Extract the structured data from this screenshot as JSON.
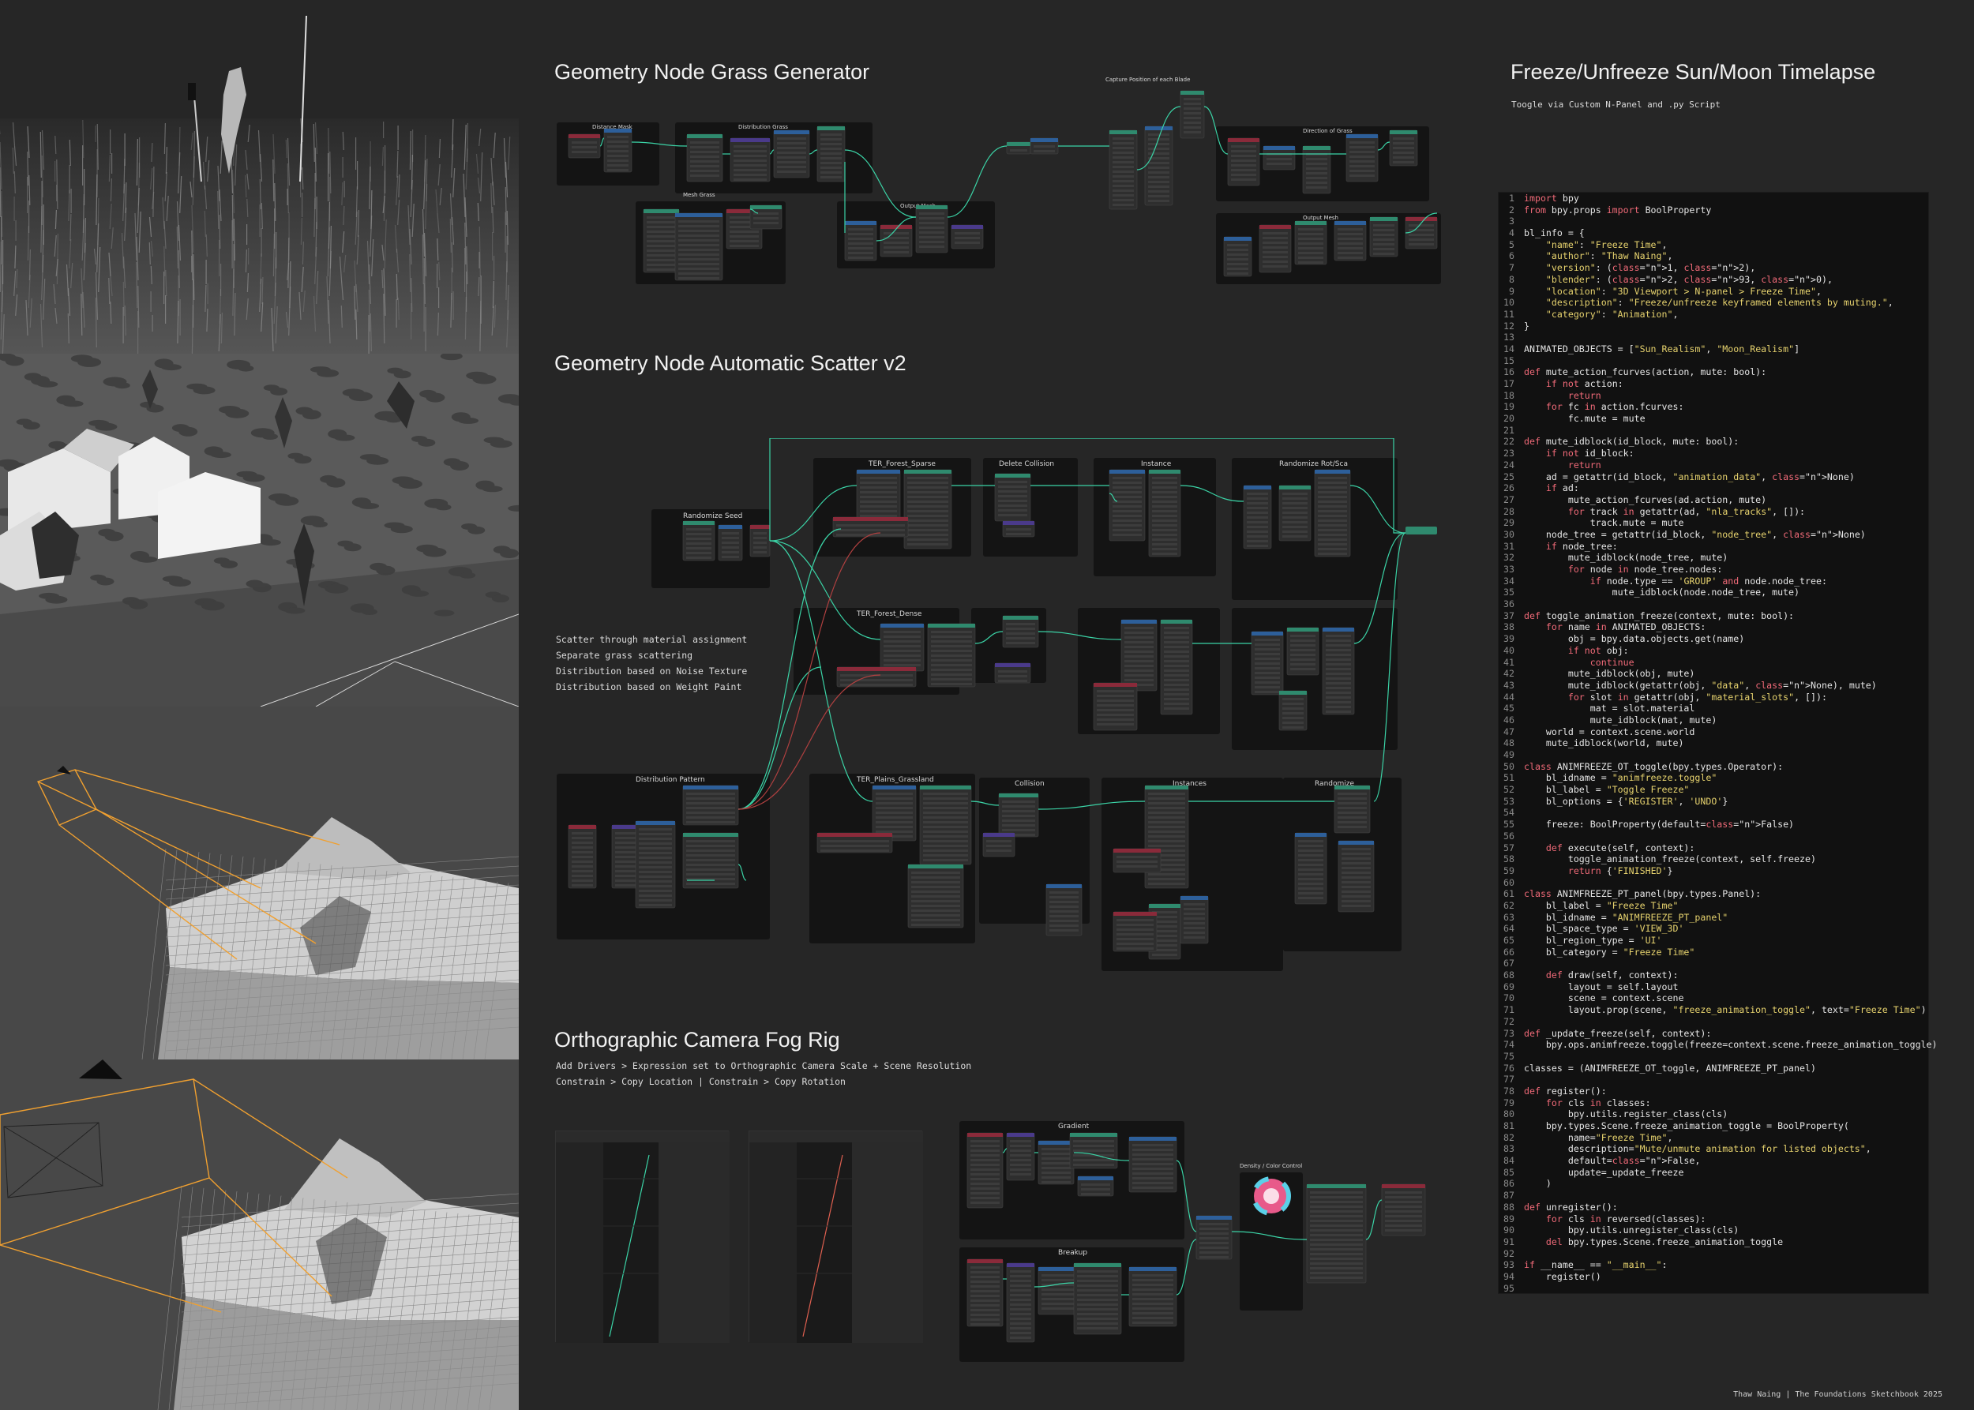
{
  "sections": {
    "grass": {
      "title": "Geometry Node Grass Generator"
    },
    "scatter": {
      "title": "Geometry Node Automatic Scatter v2",
      "notes": [
        "Scatter through material assignment",
        "Separate grass scattering",
        "Distribution based on Noise Texture",
        "Distribution based on Weight Paint"
      ]
    },
    "fog": {
      "title": "Orthographic Camera Fog Rig",
      "notes": [
        "Add Drivers > Expression set to Orthographic Camera Scale + Scene Resolution",
        "Constrain > Copy Location | Constrain > Copy Rotation"
      ]
    },
    "freeze": {
      "title": "Freeze/Unfreeze Sun/Moon Timelapse",
      "subtitle": "Toogle via Custom N-Panel and .py Script"
    }
  },
  "node_frames": {
    "grass": [
      "Distance Mask",
      "Distribution Grass",
      "Mesh Grass",
      "Output Mesh",
      "Capture Position of each Blade",
      "Direction of Grass",
      "Output Mesh"
    ],
    "scatter": [
      "Randomize Seed",
      "TER_Forest_Sparse",
      "Delete Collision",
      "Instance",
      "Randomize Rot/Sca",
      "TER_Forest_Dense",
      "Distribution Pattern",
      "TER_Plains_Grassland",
      "Collision",
      "Instances",
      "Randomize"
    ],
    "fog": [
      "Gradient",
      "Breakup",
      "Density / Color Control"
    ]
  },
  "code_lines": [
    "import bpy",
    "from bpy.props import BoolProperty",
    "",
    "bl_info = {",
    "    \"name\": \"Freeze Time\",",
    "    \"author\": \"Thaw Naing\",",
    "    \"version\": (1, 2),",
    "    \"blender\": (2, 93, 0),",
    "    \"location\": \"3D Viewport > N-panel > Freeze Time\",",
    "    \"description\": \"Freeze/unfreeze keyframed elements by muting.\",",
    "    \"category\": \"Animation\",",
    "}",
    "",
    "ANIMATED_OBJECTS = [\"Sun_Realism\", \"Moon_Realism\"]",
    "",
    "def mute_action_fcurves(action, mute: bool):",
    "    if not action:",
    "        return",
    "    for fc in action.fcurves:",
    "        fc.mute = mute",
    "",
    "def mute_idblock(id_block, mute: bool):",
    "    if not id_block:",
    "        return",
    "    ad = getattr(id_block, \"animation_data\", None)",
    "    if ad:",
    "        mute_action_fcurves(ad.action, mute)",
    "        for track in getattr(ad, \"nla_tracks\", []):",
    "            track.mute = mute",
    "    node_tree = getattr(id_block, \"node_tree\", None)",
    "    if node_tree:",
    "        mute_idblock(node_tree, mute)",
    "        for node in node_tree.nodes:",
    "            if node.type == 'GROUP' and node.node_tree:",
    "                mute_idblock(node.node_tree, mute)",
    "",
    "def toggle_animation_freeze(context, mute: bool):",
    "    for name in ANIMATED_OBJECTS:",
    "        obj = bpy.data.objects.get(name)",
    "        if not obj:",
    "            continue",
    "        mute_idblock(obj, mute)",
    "        mute_idblock(getattr(obj, \"data\", None), mute)",
    "        for slot in getattr(obj, \"material_slots\", []):",
    "            mat = slot.material",
    "            mute_idblock(mat, mute)",
    "    world = context.scene.world",
    "    mute_idblock(world, mute)",
    "",
    "class ANIMFREEZE_OT_toggle(bpy.types.Operator):",
    "    bl_idname = \"animfreeze.toggle\"",
    "    bl_label = \"Toggle Freeze\"",
    "    bl_options = {'REGISTER', 'UNDO'}",
    "",
    "    freeze: BoolProperty(default=False)",
    "",
    "    def execute(self, context):",
    "        toggle_animation_freeze(context, self.freeze)",
    "        return {'FINISHED'}",
    "",
    "class ANIMFREEZE_PT_panel(bpy.types.Panel):",
    "    bl_label = \"Freeze Time\"",
    "    bl_idname = \"ANIMFREEZE_PT_panel\"",
    "    bl_space_type = 'VIEW_3D'",
    "    bl_region_type = 'UI'",
    "    bl_category = \"Freeze Time\"",
    "",
    "    def draw(self, context):",
    "        layout = self.layout",
    "        scene = context.scene",
    "        layout.prop(scene, \"freeze_animation_toggle\", text=\"Freeze Time\")",
    "",
    "def _update_freeze(self, context):",
    "    bpy.ops.animfreeze.toggle(freeze=context.scene.freeze_animation_toggle)",
    "",
    "classes = (ANIMFREEZE_OT_toggle, ANIMFREEZE_PT_panel)",
    "",
    "def register():",
    "    for cls in classes:",
    "        bpy.utils.register_class(cls)",
    "    bpy.types.Scene.freeze_animation_toggle = BoolProperty(",
    "        name=\"Freeze Time\",",
    "        description=\"Mute/unmute animation for listed objects\",",
    "        default=False,",
    "        update=_update_freeze",
    "    )",
    "",
    "def unregister():",
    "    for cls in reversed(classes):",
    "        bpy.utils.unregister_class(cls)",
    "    del bpy.types.Scene.freeze_animation_toggle",
    "",
    "if __name__ == \"__main__\":",
    "    register()",
    ""
  ],
  "footer": "Thaw Naing | The Foundations Sketchbook 2025",
  "colors": {
    "background": "#262626",
    "node_header_green": "#2f8a6e",
    "node_header_blue": "#2d5f9a",
    "node_header_red": "#8a2a3a",
    "node_header_purple": "#4a3a8a",
    "wire": "#3bd3a6",
    "camera_frustum": "#f0a030"
  }
}
